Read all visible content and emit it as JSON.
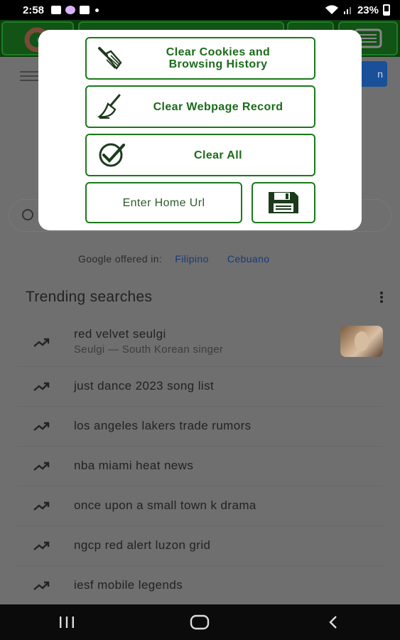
{
  "status_bar": {
    "time": "2:58",
    "battery": "23%"
  },
  "browser": {
    "offered_in_label": "Google offered in:",
    "languages": [
      "Filipino",
      "Cebuano"
    ],
    "trending_title": "Trending searches",
    "trending": [
      {
        "text": "red velvet seulgi",
        "subtitle": "Seulgi — South Korean singer",
        "has_thumb": true
      },
      {
        "text": "just dance 2023 song list"
      },
      {
        "text": "los angeles lakers trade rumors"
      },
      {
        "text": "nba miami heat news"
      },
      {
        "text": "once upon a small town k drama"
      },
      {
        "text": "ngcp red alert luzon grid"
      },
      {
        "text": "iesf mobile legends"
      }
    ]
  },
  "dialog": {
    "clear_cookies_line1": "Clear Cookies and",
    "clear_cookies_line2": "Browsing History",
    "clear_webpage_label": "Clear Webpage Record",
    "clear_all_label": "Clear All",
    "home_url_placeholder": "Enter Home Url",
    "icons": {
      "cookies": "broom-icon",
      "webpage": "broom-sweep-icon",
      "clear_all": "check-circle-icon",
      "save": "floppy-disk-icon"
    },
    "accent_color": "#1a7a1a"
  },
  "nav_bar": {
    "icons": [
      "recents-icon",
      "home-icon",
      "back-icon"
    ]
  }
}
